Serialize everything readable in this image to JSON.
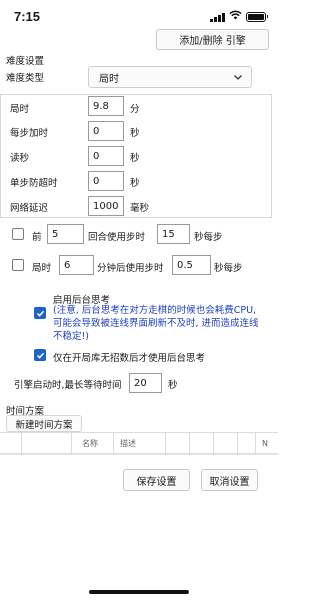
{
  "status_bar": {
    "time": "7:15"
  },
  "header": {
    "add_remove_engine_label": "添加/删除 引擎"
  },
  "difficulty": {
    "section_title": "难度设置",
    "type_label": "难度类型",
    "type_value": "局时"
  },
  "time_settings": {
    "rows": [
      {
        "label": "局时",
        "value": "9.8",
        "unit": "分"
      },
      {
        "label": "每步加时",
        "value": "0",
        "unit": "秒"
      },
      {
        "label": "读秒",
        "value": "0",
        "unit": "秒"
      },
      {
        "label": "单步防超时",
        "value": "0",
        "unit": "秒"
      },
      {
        "label": "网络延迟",
        "value": "1000",
        "unit": "毫秒"
      }
    ]
  },
  "move_rule": {
    "checked": false,
    "prefix": "前",
    "moves": "5",
    "middle": "回合使用步时",
    "seconds": "15",
    "suffix": "秒每步"
  },
  "time_rule": {
    "checked": false,
    "prefix": "局时",
    "minutes": "6",
    "middle": "分钟后使用步时",
    "seconds": "0.5",
    "suffix": "秒每步"
  },
  "background_think": {
    "checked": true,
    "label": "启用后台思考",
    "warning": "(注意, 后台思考在对方走棋的时候也会耗费CPU, 可能会导致被连线界面刷新不及时, 进而造成连线不稳定!)"
  },
  "opening_only": {
    "checked": true,
    "label": "仅在开局库无招数后才使用后台思考"
  },
  "engine_wait": {
    "label": "引擎启动时,最长等待时间",
    "value": "20",
    "unit": "秒"
  },
  "time_scheme": {
    "section_title": "时间方案",
    "new_button": "新建时间方案",
    "columns": [
      "名称",
      "描述",
      "N"
    ]
  },
  "footer": {
    "save_label": "保存设置",
    "cancel_label": "取消设置"
  }
}
